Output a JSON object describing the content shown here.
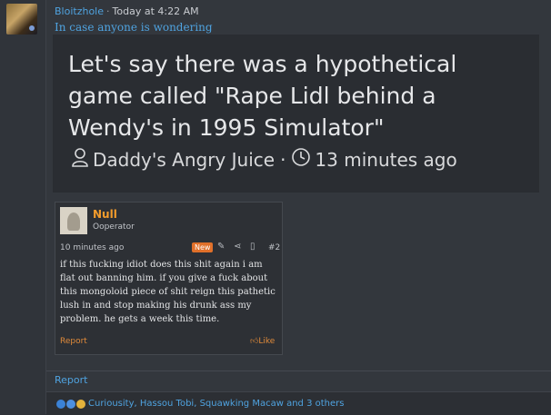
{
  "post": {
    "username": "Bloitzhole",
    "separator": "·",
    "timestamp": "Today at 4:22 AM",
    "caption": "In case anyone is wondering"
  },
  "embed": {
    "title": "Let's say there was a hypothetical game called \"Rape Lidl behind a Wendy's in 1995 Simulator\"",
    "author": "Daddy's Angry Juice",
    "dot": "·",
    "age": "13 minutes ago"
  },
  "quote": {
    "name": "Null",
    "role": "Ooperator",
    "time": "10 minutes ago",
    "badge": "New",
    "number": "#2",
    "body": "if this fucking idiot does this shit again i am flat out banning him. if you give a fuck about this mongoloid piece of shit reign this pathetic lush in and stop making his drunk ass my problem. he gets a week this time.",
    "report": "Report",
    "like": "Like"
  },
  "footer": {
    "report": "Report",
    "reactions": "Curiousity, Hassou Tobi, Squawking Macaw and 3 others"
  },
  "colors": {
    "link": "#4fa3e0",
    "accent": "#f39c2c"
  }
}
